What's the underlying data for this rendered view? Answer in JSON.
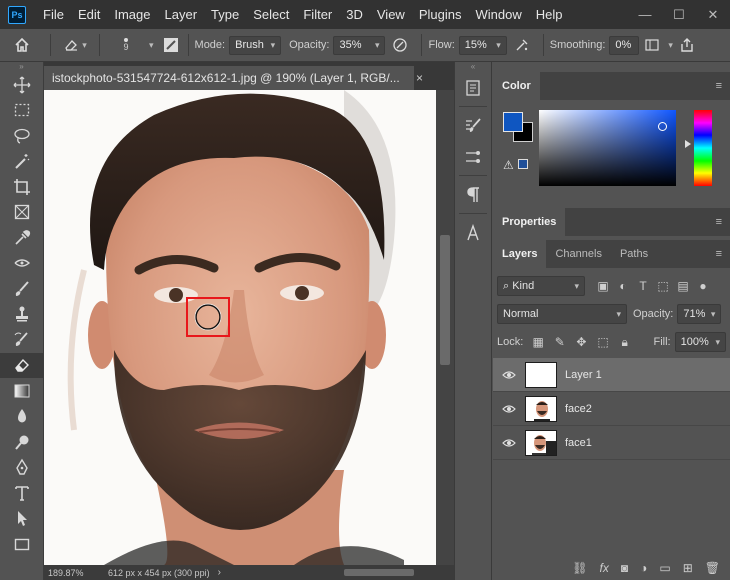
{
  "app": {
    "logo": "Ps"
  },
  "menu": [
    "File",
    "Edit",
    "Image",
    "Layer",
    "Type",
    "Select",
    "Filter",
    "3D",
    "View",
    "Plugins",
    "Window",
    "Help"
  ],
  "window_controls": {
    "minimize": "—",
    "maximize": "☐",
    "close": "✕"
  },
  "options": {
    "brush_size": "9",
    "mode_label": "Mode:",
    "mode_value": "Brush",
    "opacity_label": "Opacity:",
    "opacity_value": "35%",
    "flow_label": "Flow:",
    "flow_value": "15%",
    "smoothing_label": "Smoothing:",
    "smoothing_value": "0%"
  },
  "document": {
    "tab_title": "istockphoto-531547724-612x612-1.jpg @ 190% (Layer 1, RGB/...",
    "tab_close": "×",
    "zoom": "189.87%",
    "info": "612 px x 454 px (300 ppi)"
  },
  "panels": {
    "color_tab": "Color",
    "properties_tab": "Properties",
    "layers_tab": "Layers",
    "channels_tab": "Channels",
    "paths_tab": "Paths",
    "menu_icon": "≡"
  },
  "color": {
    "foreground": "#0f56c1",
    "background": "#000000"
  },
  "layers": {
    "filter_value": "Kind",
    "blend_mode": "Normal",
    "opacity_label": "Opacity:",
    "opacity_value": "71%",
    "lock_label": "Lock:",
    "fill_label": "Fill:",
    "fill_value": "100%",
    "items": [
      {
        "name": "Layer 1",
        "selected": true
      },
      {
        "name": "face2",
        "selected": false
      },
      {
        "name": "face1",
        "selected": false
      }
    ]
  },
  "accent_colors": {
    "highlight_box": "#e8171b",
    "panel_bg": "#535353",
    "menubar_bg": "#323232"
  }
}
